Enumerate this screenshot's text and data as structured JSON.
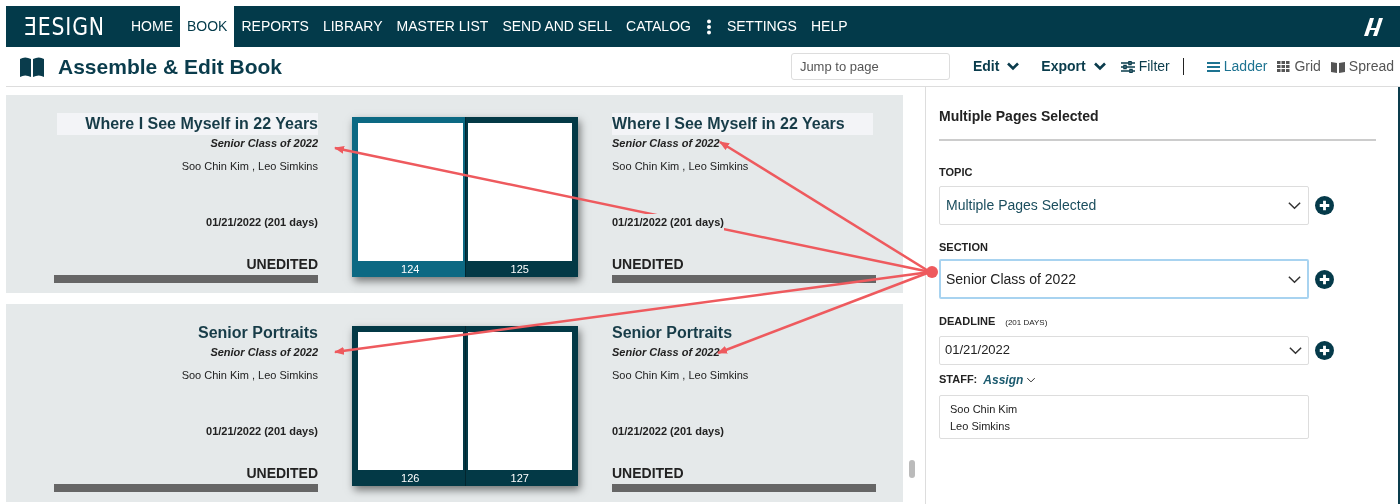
{
  "nav": {
    "logo": "ƎESIGN",
    "items": [
      {
        "label": "HOME",
        "selected": false
      },
      {
        "label": "BOOK",
        "selected": true
      },
      {
        "label": "REPORTS",
        "selected": false
      },
      {
        "label": "LIBRARY",
        "selected": false
      },
      {
        "label": "MASTER LIST",
        "selected": false
      },
      {
        "label": "SEND AND SELL",
        "selected": false
      },
      {
        "label": "CATALOG",
        "selected": false
      },
      {
        "label": "SETTINGS",
        "selected": false
      },
      {
        "label": "HELP",
        "selected": false
      }
    ]
  },
  "header": {
    "title": "Assemble & Edit Book",
    "jump": {
      "placeholder": "Jump to page"
    },
    "menus": [
      "Edit",
      "Export"
    ],
    "filter": "Filter",
    "views": [
      {
        "label": "Ladder",
        "selected": true,
        "kind": "ladder"
      },
      {
        "label": "Grid",
        "selected": false,
        "kind": "grid"
      },
      {
        "label": "Spread",
        "selected": false,
        "kind": "spread"
      }
    ]
  },
  "spreads": [
    {
      "pages": [
        {
          "title": "Where I See Myself in 22 Years",
          "section": "Senior Class of 2022",
          "staff": "Soo Chin Kim , Leo Simkins",
          "deadline": "01/21/2022 (201 days)",
          "status": "UNEDITED",
          "number": "124",
          "level": 0,
          "selected": true,
          "active": true
        },
        {
          "title": "Where I See Myself in 22 Years",
          "section": "Senior Class of 2022",
          "staff": "Soo Chin Kim , Leo Simkins",
          "deadline": "01/21/2022 (201 days)",
          "status": "UNEDITED",
          "number": "125",
          "level": 0,
          "selected": true,
          "active": false
        }
      ]
    },
    {
      "pages": [
        {
          "title": "Senior Portraits",
          "section": "Senior Class of 2022",
          "staff": "Soo Chin Kim , Leo Simkins",
          "deadline": "01/21/2022 (201 days)",
          "status": "UNEDITED",
          "number": "126",
          "level": 0,
          "selected": false,
          "active": false
        },
        {
          "title": "Senior Portraits",
          "section": "Senior Class of 2022",
          "staff": "Soo Chin Kim , Leo Simkins",
          "deadline": "01/21/2022 (201 days)",
          "status": "UNEDITED",
          "number": "127",
          "level": 0,
          "selected": false,
          "active": false
        }
      ]
    }
  ],
  "panel": {
    "title": "Multiple Pages Selected",
    "topic": {
      "label": "TOPIC",
      "value": "Multiple Pages Selected"
    },
    "section": {
      "label": "SECTION",
      "value": "Senior Class of 2022",
      "focused": true
    },
    "deadline": {
      "label": "DEADLINE",
      "note": "(201 DAYS)",
      "value": "01/21/2022"
    },
    "staff": {
      "label": "STAFF:",
      "assign": "Assign",
      "members": [
        "Soo Chin Kim",
        "Leo Simkins"
      ]
    }
  }
}
